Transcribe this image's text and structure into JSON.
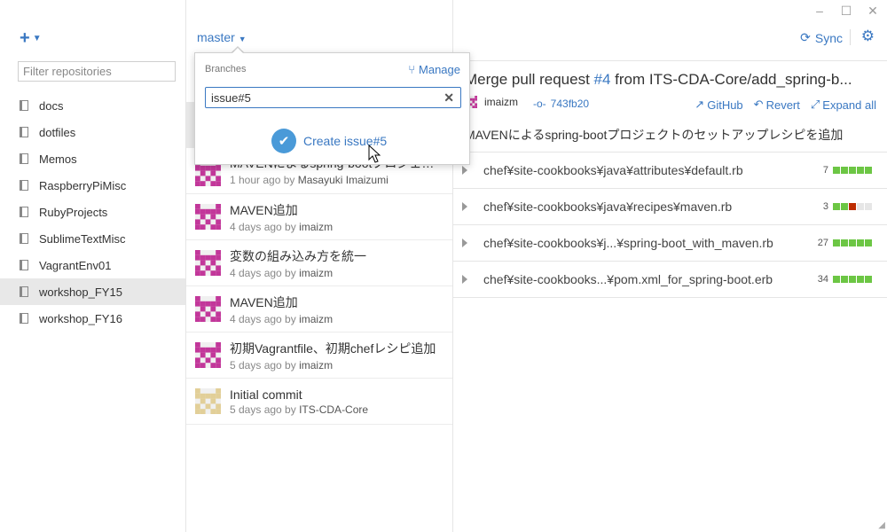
{
  "window": {
    "min": "–",
    "max": "☐",
    "close": "✕"
  },
  "sidebar": {
    "add_label": "+",
    "filter_placeholder": "Filter repositories",
    "repos": [
      {
        "name": "docs"
      },
      {
        "name": "dotfiles"
      },
      {
        "name": "Memos"
      },
      {
        "name": "RaspberryPiMisc"
      },
      {
        "name": "RubyProjects"
      },
      {
        "name": "SublimeTextMisc"
      },
      {
        "name": "VagrantEnv01"
      },
      {
        "name": "workshop_FY15",
        "selected": true
      },
      {
        "name": "workshop_FY16"
      }
    ]
  },
  "toolbar": {
    "branch": "master",
    "sync": "Sync"
  },
  "branch_popup": {
    "label": "Branches",
    "manage": "Manage",
    "input_value": "issue#5",
    "create_label": "Create issue#5"
  },
  "commits": [
    {
      "title": "MAVENによるspring-bootプロジェクトの...",
      "time": "1 hour ago by",
      "author": "Masayuki Imaizumi",
      "avatar": "pink"
    },
    {
      "title": "MAVEN追加",
      "time": "4 days ago by",
      "author": "imaizm",
      "avatar": "pink"
    },
    {
      "title": "変数の組み込み方を統一",
      "time": "4 days ago by",
      "author": "imaizm",
      "avatar": "pink"
    },
    {
      "title": "MAVEN追加",
      "time": "4 days ago by",
      "author": "imaizm",
      "avatar": "pink"
    },
    {
      "title": "初期Vagrantfile、初期chefレシピ追加",
      "time": "5 days ago by",
      "author": "imaizm",
      "avatar": "pink"
    },
    {
      "title": "Initial commit",
      "time": "5 days ago by",
      "author": "ITS-CDA-Core",
      "avatar": "tan"
    }
  ],
  "detail": {
    "title_prefix": "Merge pull request ",
    "title_num": "#4",
    "title_suffix": " from ITS-CDA-Core/add_spring-b...",
    "author": "imaizm",
    "sha": "743fb20",
    "actions": {
      "github": "GitHub",
      "revert": "Revert",
      "expand": "Expand all"
    },
    "description": "MAVENによるspring-bootプロジェクトのセットアップレシピを追加",
    "files": [
      {
        "path": "chef¥site-cookbooks¥java¥attributes¥default.rb",
        "count": "7",
        "bars": [
          "g",
          "g",
          "g",
          "g",
          "g"
        ]
      },
      {
        "path": "chef¥site-cookbooks¥java¥recipes¥maven.rb",
        "count": "3",
        "bars": [
          "g",
          "g",
          "r",
          "e",
          "e"
        ]
      },
      {
        "path": "chef¥site-cookbooks¥j...¥spring-boot_with_maven.rb",
        "count": "27",
        "bars": [
          "g",
          "g",
          "g",
          "g",
          "g"
        ]
      },
      {
        "path": "chef¥site-cookbooks...¥pom.xml_for_spring-boot.erb",
        "count": "34",
        "bars": [
          "g",
          "g",
          "g",
          "g",
          "g"
        ]
      }
    ]
  },
  "colors": {
    "accent": "#3a78c2",
    "added": "#6cc644",
    "removed": "#bd2c00",
    "empty": "#e6e6e6",
    "avatar_pink": "#c2379a",
    "avatar_tan": "#e2cf98"
  }
}
